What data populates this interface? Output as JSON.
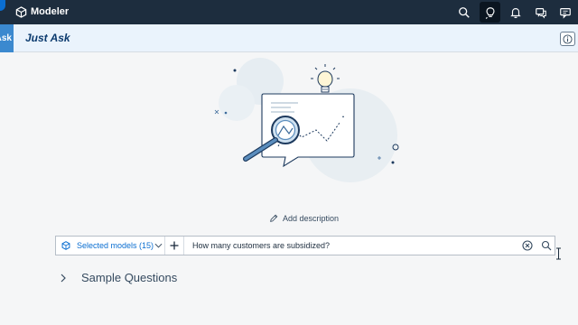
{
  "shell": {
    "app_title": "Modeler",
    "icons": [
      "home-icon",
      "app-cube-icon",
      "search-icon",
      "just-ask-icon",
      "notifications-icon",
      "feedback-icon",
      "messages-icon"
    ]
  },
  "subheader": {
    "tab_label": "Ask",
    "title": "Just Ask",
    "info_icon": "info-icon"
  },
  "illustration": {
    "name": "magnifier-lightbulb-chart-illustration"
  },
  "add_description": {
    "label": "Add description",
    "icon": "pencil-icon"
  },
  "search": {
    "models_label": "Selected models (15)",
    "query": "How many customers are subsidized?",
    "icons": [
      "cube-icon",
      "chevron-down-icon",
      "add-icon",
      "clear-icon",
      "search-icon"
    ]
  },
  "sample_questions": {
    "label": "Sample Questions",
    "icon": "chevron-right-icon"
  },
  "colors": {
    "shell_bg": "#1d2d3e",
    "subheader_bg": "#eaf3fc",
    "accent": "#0a6ed1",
    "title": "#0b3a6e",
    "page_bg": "#f5f6f7"
  }
}
